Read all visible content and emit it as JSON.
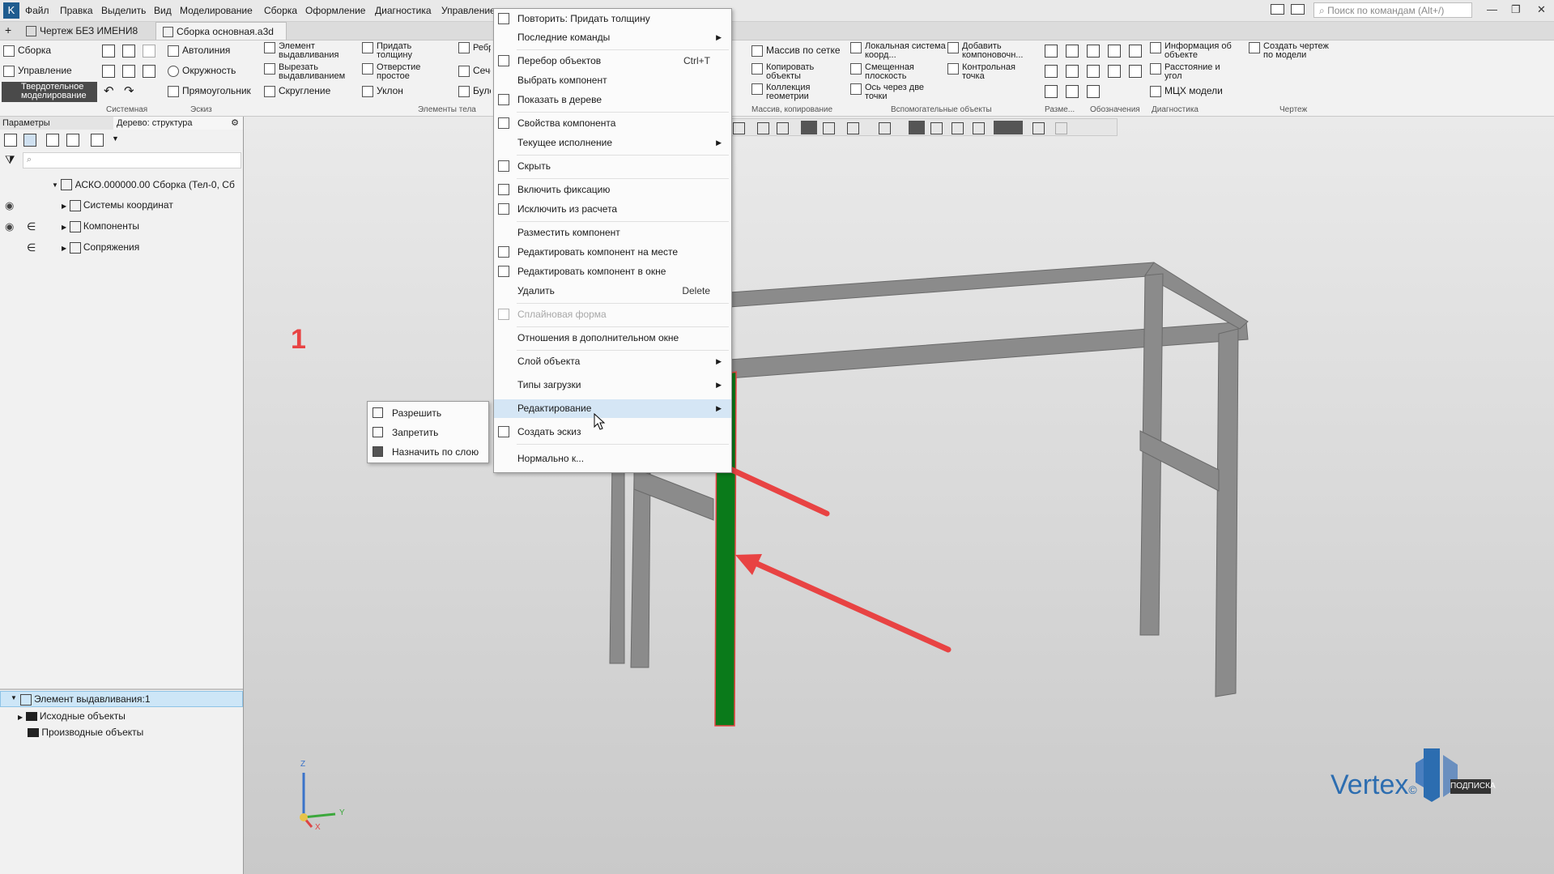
{
  "menubar": {
    "items": [
      "Файл",
      "Правка",
      "Выделить",
      "Вид",
      "Моделирование",
      "Сборка",
      "Оформление",
      "Диагностика",
      "Управление"
    ],
    "search_placeholder": "Поиск по командам (Alt+/)"
  },
  "tabs": [
    {
      "label": "Чертеж БЕЗ ИМЕНИ8"
    },
    {
      "label": "Сборка основная.a3d",
      "close": "×"
    }
  ],
  "ribbon": {
    "left_modes": [
      "Сборка",
      "Управление",
      "Твердотельное моделирование"
    ],
    "sketch_tools": [
      "Автолиния",
      "Окружность",
      "Прямоугольник"
    ],
    "body_tools": {
      "extrude": "Элемент выдавливания",
      "cut_extrude": "Вырезать выдавливанием",
      "fillet": "Скругление",
      "thicken": "Придать толщину",
      "hole": "Отверстие простое",
      "draft": "Уклон",
      "rib": "Ребро жесткости",
      "section": "Сечение",
      "boolean": "Булева операция"
    },
    "array_tools": [
      "Массив по сетке",
      "Копировать объекты",
      "Коллекция геометрии"
    ],
    "aux_tools": [
      "Локальная система коорд...",
      "Смещенная плоскость",
      "Ось через две точки",
      "Добавить компоновочн...",
      "Контрольная точка"
    ],
    "diag_tools": [
      "Информация об объекте",
      "Расстояние и угол",
      "МЦХ модели"
    ],
    "drawing_tool": "Создать чертеж по модели",
    "groups": [
      "Системная",
      "Эскиз",
      "Элементы тела",
      "Массив, копирование",
      "Вспомогательные объекты",
      "Разме...",
      "Обозначения",
      "Диагностика",
      "Чертеж"
    ]
  },
  "left_panel": {
    "params_tab": "Параметры",
    "tree_tab": "Дерево: структура",
    "root": "АСКО.000000.00 Сборка (Тел-0, Сб",
    "children": [
      "Системы координат",
      "Компоненты",
      "Сопряжения"
    ],
    "bottom_tree": {
      "selected": "Элемент выдавливания:1",
      "children": [
        "Исходные объекты",
        "Производные объекты"
      ]
    }
  },
  "context_menu": {
    "items": [
      {
        "label": "Повторить: Придать толщину"
      },
      {
        "label": "Последние команды",
        "arrow": "▶"
      },
      {
        "label": "Перебор объектов",
        "shortcut": "Ctrl+T"
      },
      {
        "label": "Выбрать компонент"
      },
      {
        "label": "Показать в дереве"
      },
      {
        "label": "Свойства компонента"
      },
      {
        "label": "Текущее исполнение",
        "arrow": "▶"
      },
      {
        "label": "Скрыть"
      },
      {
        "label": "Включить фиксацию"
      },
      {
        "label": "Исключить из расчета"
      },
      {
        "label": "Разместить компонент"
      },
      {
        "label": "Редактировать компонент на месте"
      },
      {
        "label": "Редактировать компонент в окне"
      },
      {
        "label": "Удалить",
        "shortcut": "Delete"
      },
      {
        "label": "Сплайновая форма"
      },
      {
        "label": "Отношения в дополнительном окне"
      },
      {
        "label": "Слой объекта",
        "arrow": "▶"
      },
      {
        "label": "Типы загрузки",
        "arrow": "▶"
      },
      {
        "label": "Редактирование",
        "arrow": "▶"
      },
      {
        "label": "Создать эскиз"
      },
      {
        "label": "Нормально к..."
      }
    ]
  },
  "submenu": {
    "items": [
      "Разрешить",
      "Запретить",
      "Назначить по слою"
    ]
  },
  "annotation": {
    "number": "1"
  },
  "axes": {
    "z": "Z",
    "y": "Y",
    "x": "X"
  },
  "logo": {
    "brand": "Vertex",
    "mark": "©",
    "tag": "ПОДПИСКА"
  },
  "colors": {
    "accent": "#2c6db0",
    "arrow": "#e84343",
    "highlight": "#0a7a1a",
    "frame": "#8a8a8a"
  }
}
